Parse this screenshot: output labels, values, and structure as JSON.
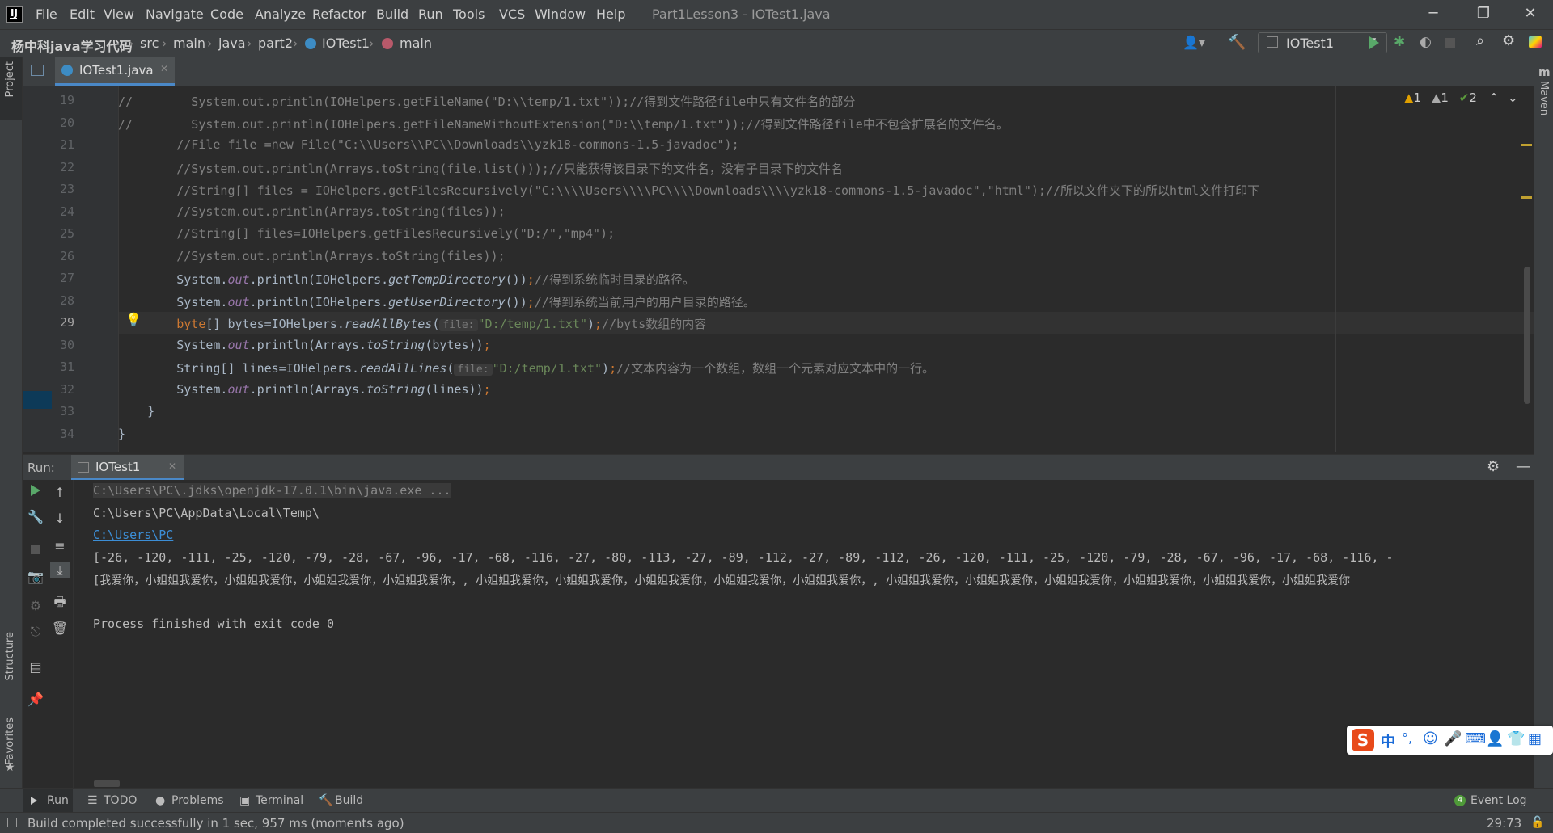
{
  "titlebar": {
    "menus": [
      "File",
      "Edit",
      "View",
      "Navigate",
      "Code",
      "Analyze",
      "Refactor",
      "Build",
      "Run",
      "Tools",
      "VCS",
      "Window",
      "Help"
    ],
    "title": "Part1Lesson3 - IOTest1.java",
    "minimize_icon": "─",
    "restore_icon": "❐",
    "close_icon": "✕"
  },
  "navbar": {
    "crumbs": [
      "杨中科java学习代码",
      "src",
      "main",
      "java",
      "part2",
      "IOTest1",
      "main"
    ],
    "run_config": "IOTest1"
  },
  "tool_windows": {
    "project": "Project",
    "structure": "Structure",
    "favorites": "Favorites",
    "maven": "Maven"
  },
  "editor": {
    "tab_label": "IOTest1.java",
    "inspections": {
      "warn1": "1",
      "warn2": "1",
      "ok": "2"
    },
    "lines": [
      {
        "n": "19",
        "code": "//        System.out.println(IOHelpers.getFileName(\"D:\\\\temp/1.txt\"));//得到文件路径file中只有文件名的部分"
      },
      {
        "n": "20",
        "code": "//        System.out.println(IOHelpers.getFileNameWithoutExtension(\"D:\\\\temp/1.txt\"));//得到文件路径file中不包含扩展名的文件名。"
      },
      {
        "n": "21",
        "code": "        //File file =new File(\"C:\\\\Users\\\\PC\\\\Downloads\\\\yzk18-commons-1.5-javadoc\");"
      },
      {
        "n": "22",
        "code": "        //System.out.println(Arrays.toString(file.list()));//只能获得该目录下的文件名，没有子目录下的文件名"
      },
      {
        "n": "23",
        "code": "        //String[] files = IOHelpers.getFilesRecursively(\"C:\\\\\\\\Users\\\\\\\\PC\\\\\\\\Downloads\\\\\\\\yzk18-commons-1.5-javadoc\",\"html\");//所以文件夹下的所以html文件打印下"
      },
      {
        "n": "24",
        "code": "        //System.out.println(Arrays.toString(files));"
      },
      {
        "n": "25",
        "code": "        //String[] files=IOHelpers.getFilesRecursively(\"D:/\",\"mp4\");"
      },
      {
        "n": "26",
        "code": "        //System.out.println(Arrays.toString(files));"
      },
      {
        "n": "27",
        "a": "        System.",
        "b": "out",
        "c": ".println(IOHelpers.",
        "d": "getTempDirectory",
        "e": "());",
        "f": "//得到系统临时目录的路径。"
      },
      {
        "n": "28",
        "a": "        System.",
        "b": "out",
        "c": ".println(IOHelpers.",
        "d": "getUserDirectory",
        "e": "());",
        "f": "//得到系统当前用户的用户目录的路径。"
      },
      {
        "n": "29",
        "kw": "byte",
        "a": "[] bytes=IOHelpers.",
        "d": "readAllBytes",
        "hint": "file:",
        "str": "\"D:/temp/1.txt\"",
        "e": ");",
        "f": "//byts数组的内容"
      },
      {
        "n": "30",
        "a": "        System.",
        "b": "out",
        "c": ".println(Arrays.",
        "d": "toString",
        "e": "(bytes));"
      },
      {
        "n": "31",
        "a": "        String[] lines=IOHelpers.",
        "d": "readAllLines",
        "hint": "file:",
        "str": "\"D:/temp/1.txt\"",
        "e": ");",
        "f": "//文本内容为一个数组，数组一个元素对应文本中的一行。"
      },
      {
        "n": "32",
        "a": "        System.",
        "b": "out",
        "c": ".println(Arrays.",
        "d": "toString",
        "e": "(lines));"
      },
      {
        "n": "33",
        "code": "    }"
      },
      {
        "n": "34",
        "code": "}"
      }
    ]
  },
  "run_panel": {
    "label": "Run:",
    "tab": "IOTest1",
    "output": [
      "C:\\Users\\PC\\.jdks\\openjdk-17.0.1\\bin\\java.exe ...",
      "C:\\Users\\PC\\AppData\\Local\\Temp\\",
      "C:\\Users\\PC",
      "[-26, -120, -111, -25, -120, -79, -28, -67, -96, -17, -68, -116, -27, -80, -113, -27, -89, -112, -27, -89, -112, -26, -120, -111, -25, -120, -79, -28, -67, -96, -17, -68, -116, -",
      "[我爱你，小姐姐我爱你，小姐姐我爱你，小姐姐我爱你，小姐姐我爱你，, 小姐姐我爱你，小姐姐我爱你，小姐姐我爱你，小姐姐我爱你，小姐姐我爱你，, 小姐姐我爱你，小姐姐我爱你，小姐姐我爱你，小姐姐我爱你，小姐姐我爱你，小姐姐我爱你",
      "",
      "Process finished with exit code 0"
    ]
  },
  "bottom_tabs": [
    "Run",
    "TODO",
    "Problems",
    "Terminal",
    "Build"
  ],
  "event_log": "Event Log",
  "status": {
    "message": "Build completed successfully in 1 sec, 957 ms (moments ago)",
    "position": "29:73"
  },
  "ime": {
    "logo": "S",
    "mode": "中",
    "punct": "°,"
  }
}
